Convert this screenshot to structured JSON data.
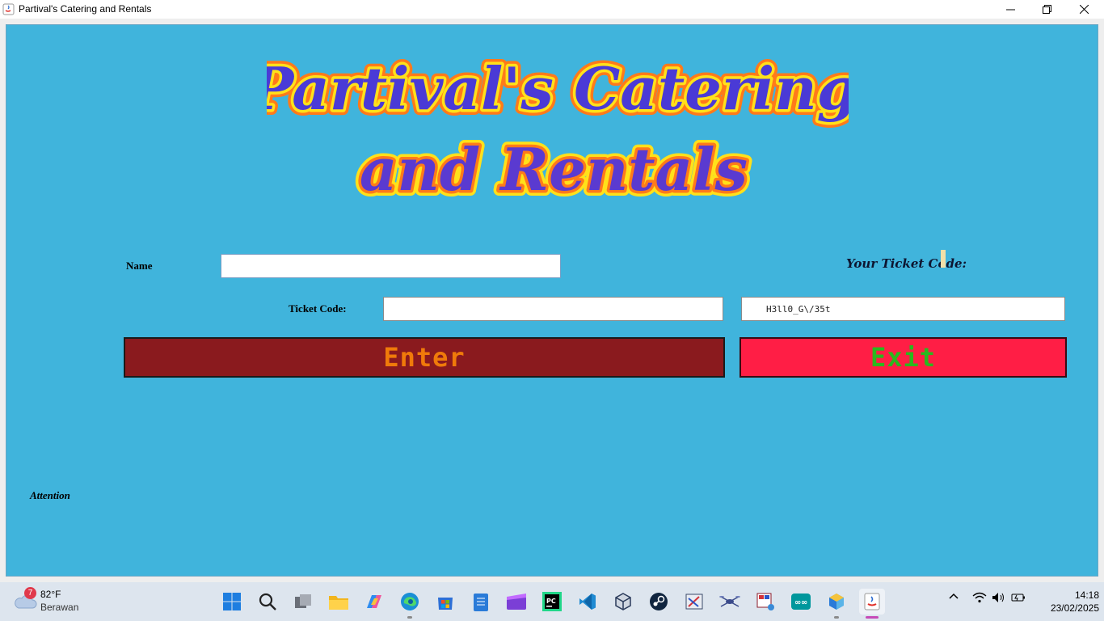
{
  "window": {
    "title": "Partival's Catering and Rentals"
  },
  "logo": {
    "line1": "Partival's Catering",
    "line2": "and Rentals"
  },
  "form": {
    "name_label": "Name",
    "name_value": "",
    "ticket_code_label": "Ticket Code:",
    "ticket_code_value": "",
    "your_ticket_code_label": "Your Ticket Code:",
    "generated_code": "H3ll0_G\\/35t",
    "enter_label": "Enter",
    "exit_label": "Exit",
    "attention_label": "Attention"
  },
  "colors": {
    "background": "#40b4dc",
    "enter_bg": "#8a1a1e",
    "enter_text": "#f07a0a",
    "exit_bg": "#ff1e45",
    "exit_text": "#2ab81e"
  },
  "taskbar": {
    "weather_temp": "82°F",
    "weather_desc": "Berawan",
    "weather_badge": "7",
    "time": "14:18",
    "date": "23/02/2025",
    "icons": [
      "windows-start-icon",
      "search-icon",
      "task-view-icon",
      "file-explorer-icon",
      "copilot-icon",
      "edge-browser-icon",
      "microsoft-store-icon",
      "notepad-icon",
      "clipchamp-icon",
      "pycharm-icon",
      "vscode-icon",
      "virtualbox-icon",
      "steam-icon",
      "snipping-tool-icon",
      "drone-app-icon",
      "paint-tool-icon",
      "arduino-icon",
      "package-app-icon",
      "java-app-icon"
    ]
  }
}
